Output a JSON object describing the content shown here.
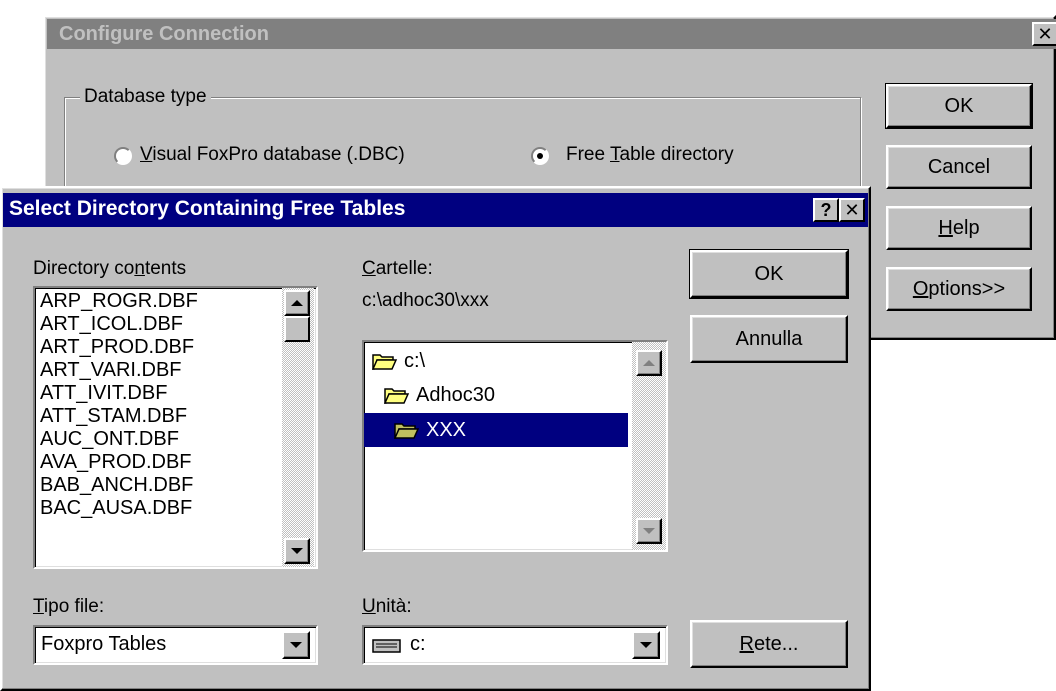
{
  "configure": {
    "title": "Configure Connection",
    "close_glyph": "✕",
    "group_label": "Database type",
    "radio_dbc_pre": "",
    "radio_dbc_u": "V",
    "radio_dbc_post": "isual FoxPro database (.DBC)",
    "radio_free_pre": "Free ",
    "radio_free_u": "T",
    "radio_free_post": "able directory",
    "ok": "OK",
    "cancel": "Cancel",
    "help_u": "H",
    "help_post": "elp",
    "options_u": "O",
    "options_post": "ptions>>"
  },
  "select": {
    "title": "Select Directory Containing Free Tables",
    "help_glyph": "?",
    "close_glyph": "✕",
    "dir_contents_pre": "Directory co",
    "dir_contents_u": "n",
    "dir_contents_post": "tents",
    "files": [
      "ARP_ROGR.DBF",
      "ART_ICOL.DBF",
      "ART_PROD.DBF",
      "ART_VARI.DBF",
      "ATT_IVIT.DBF",
      "ATT_STAM.DBF",
      "AUC_ONT.DBF",
      "AVA_PROD.DBF",
      "BAB_ANCH.DBF",
      "BAC_AUSA.DBF"
    ],
    "cartelle_u": "C",
    "cartelle_post": "artelle:",
    "current_path": "c:\\adhoc30\\xxx",
    "folders": [
      "c:\\",
      "Adhoc30",
      "XXX"
    ],
    "ok": "OK",
    "annulla": "Annulla",
    "tipo_u": "T",
    "tipo_post": "ipo file:",
    "tipo_value": "Foxpro Tables",
    "unita_u": "U",
    "unita_post": "nità:",
    "unita_value": "c:",
    "rete_u": "R",
    "rete_post": "ete..."
  },
  "colors": {
    "active_title": "#000080",
    "inactive_title": "#808080",
    "face": "#c0c0c0",
    "selection": "#000080"
  }
}
